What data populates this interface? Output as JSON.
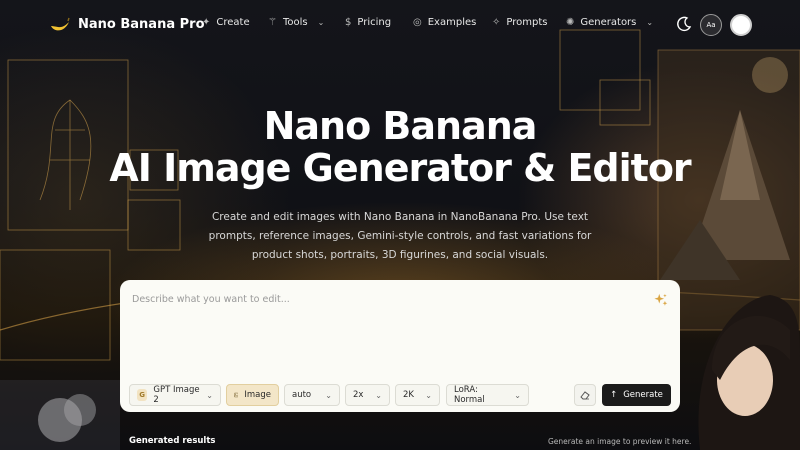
{
  "nav": {
    "brand": "Nano Banana Pro",
    "items": [
      {
        "label": "Create",
        "icon": "sparkle-icon",
        "dropdown": false
      },
      {
        "label": "Tools",
        "icon": "magic-wand-icon",
        "dropdown": true
      },
      {
        "label": "Pricing",
        "icon": "dollar-icon",
        "dropdown": false
      },
      {
        "label": "Examples",
        "icon": "compass-icon",
        "dropdown": false
      },
      {
        "label": "Prompts",
        "icon": "sparkles-icon",
        "dropdown": false
      },
      {
        "label": "Generators",
        "icon": "sparkle-star-icon",
        "dropdown": true
      }
    ],
    "font_button": "Aa"
  },
  "hero": {
    "title_line1": "Nano Banana",
    "title_line2": "AI Image Generator & Editor",
    "subtitle": "Create and edit images with Nano Banana in NanoBanana Pro. Use text prompts, reference images, Gemini-style controls, and fast variations for product shots, portraits, 3D figurines, and social visuals."
  },
  "editor": {
    "placeholder": "Describe what you want to edit...",
    "model": "GPT Image 2",
    "model_badge": "G",
    "mode": "Image",
    "aspect": "auto",
    "count": "2x",
    "resolution": "2K",
    "lora": "LoRA: Normal",
    "generate_label": "Generate"
  },
  "results": {
    "label": "Generated results",
    "hint": "Generate an image to preview it here."
  },
  "colors": {
    "accent": "#d9a441",
    "card_bg": "#fbfbf6",
    "generate_bg": "#1b1b1b"
  }
}
